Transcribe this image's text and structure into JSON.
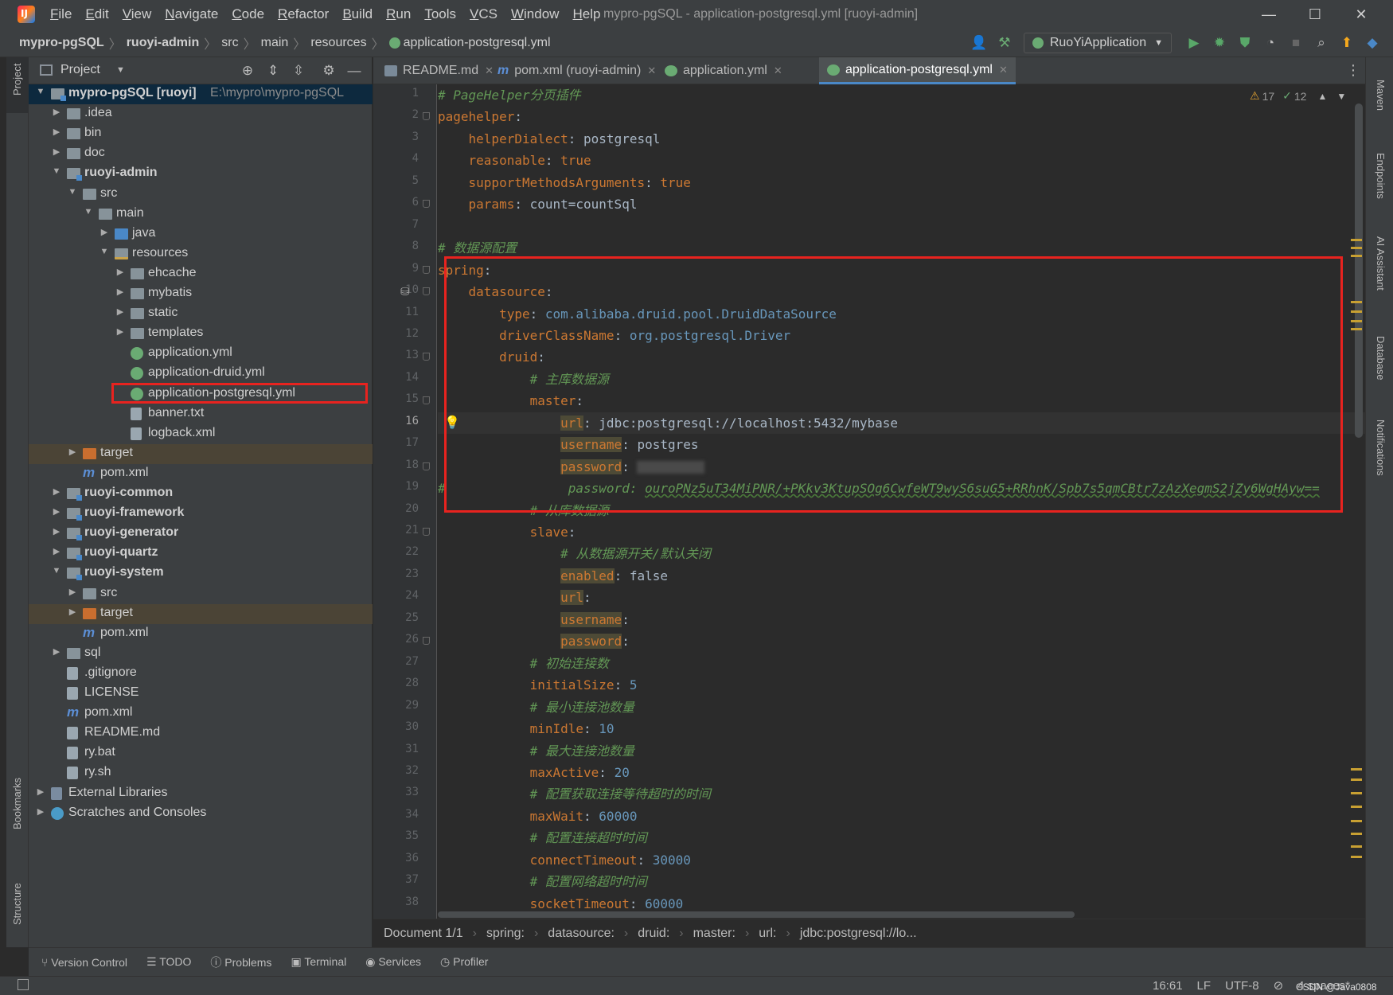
{
  "window": {
    "title": "mypro-pgSQL - application-postgresql.yml [ruoyi-admin]",
    "menu": [
      "File",
      "Edit",
      "View",
      "Navigate",
      "Code",
      "Refactor",
      "Build",
      "Run",
      "Tools",
      "VCS",
      "Window",
      "Help"
    ],
    "minimize": "—",
    "maximize": "☐",
    "close": "✕"
  },
  "breadcrumb": [
    "mypro-pgSQL",
    "ruoyi-admin",
    "src",
    "main",
    "resources",
    "application-postgresql.yml"
  ],
  "run_config": "RuoYiApplication",
  "project_pane": {
    "title": "Project",
    "tree": [
      {
        "label": "mypro-pgSQL [ruoyi]",
        "path": "E:\\mypro\\mypro-pgSQL"
      },
      {
        "label": ".idea"
      },
      {
        "label": "bin"
      },
      {
        "label": "doc"
      },
      {
        "label": "ruoyi-admin"
      },
      {
        "label": "src"
      },
      {
        "label": "main"
      },
      {
        "label": "java"
      },
      {
        "label": "resources"
      },
      {
        "label": "ehcache"
      },
      {
        "label": "mybatis"
      },
      {
        "label": "static"
      },
      {
        "label": "templates"
      },
      {
        "label": "application.yml"
      },
      {
        "label": "application-druid.yml"
      },
      {
        "label": "application-postgresql.yml"
      },
      {
        "label": "banner.txt"
      },
      {
        "label": "logback.xml"
      },
      {
        "label": "target"
      },
      {
        "label": "pom.xml"
      },
      {
        "label": "ruoyi-common"
      },
      {
        "label": "ruoyi-framework"
      },
      {
        "label": "ruoyi-generator"
      },
      {
        "label": "ruoyi-quartz"
      },
      {
        "label": "ruoyi-system"
      },
      {
        "label": "src"
      },
      {
        "label": "target"
      },
      {
        "label": "pom.xml"
      },
      {
        "label": "sql"
      },
      {
        "label": ".gitignore"
      },
      {
        "label": "LICENSE"
      },
      {
        "label": "pom.xml"
      },
      {
        "label": "README.md"
      },
      {
        "label": "ry.bat"
      },
      {
        "label": "ry.sh"
      },
      {
        "label": "External Libraries"
      },
      {
        "label": "Scratches and Consoles"
      }
    ]
  },
  "left_stripe": {
    "project": "Project",
    "bookmarks": "Bookmarks",
    "structure": "Structure"
  },
  "right_stripe": [
    "Maven",
    "Endpoints",
    "AI Assistant",
    "Database",
    "Notifications"
  ],
  "tabs": [
    {
      "label": "README.md"
    },
    {
      "label": "pom.xml (ruoyi-admin)"
    },
    {
      "label": "application.yml"
    },
    {
      "label": "application-postgresql.yml"
    }
  ],
  "inspections": {
    "warnings": "17",
    "weak": "12"
  },
  "code_lines": [
    "# PageHelper分页插件",
    "pagehelper:",
    "    helperDialect: postgresql",
    "    reasonable: true",
    "    supportMethodsArguments: true",
    "    params: count=countSql",
    "",
    "# 数据源配置",
    "spring:",
    "    datasource:",
    "        type: com.alibaba.druid.pool.DruidDataSource",
    "        driverClassName: org.postgresql.Driver",
    "        druid:",
    "            # 主库数据源",
    "            master:",
    "                url: jdbc:postgresql://localhost:5432/mybase",
    "                username: postgres",
    "                password: ",
    "#                password: ouroPNz5uT34MiPNR/+PKkv3KtupSOg6CwfeWT9wyS6suG5+RRhnK/Spb7s5qmCBtr7zAzXegmS2jZy6WgHAyw==",
    "            # 从库数据源",
    "            slave:",
    "                # 从数据源开关/默认关闭",
    "                enabled: false",
    "                url:",
    "                username:",
    "                password:",
    "            # 初始连接数",
    "            initialSize: 5",
    "            # 最小连接池数量",
    "            minIdle: 10",
    "            # 最大连接池数量",
    "            maxActive: 20",
    "            # 配置获取连接等待超时的时间",
    "            maxWait: 60000",
    "            # 配置连接超时时间",
    "            connectTimeout: 30000",
    "            # 配置网络超时时间",
    "            socketTimeout: 60000"
  ],
  "editor_breadcrumb": [
    "Document 1/1",
    "spring:",
    "datasource:",
    "druid:",
    "master:",
    "url:",
    "jdbc:postgresql://lo..."
  ],
  "bottom_tabs": [
    "Version Control",
    "TODO",
    "Problems",
    "Terminal",
    "Services",
    "Profiler"
  ],
  "status": {
    "position": "16:61",
    "line_sep": "LF",
    "encoding": "UTF-8",
    "indent": "4 spaces*"
  },
  "watermark": "CSDN @Java0808",
  "colors": {
    "accent": "#4a88c7",
    "highlight_box": "#e8231f",
    "keyword": "#cc7832",
    "comment": "#629755",
    "number": "#6897bb"
  }
}
